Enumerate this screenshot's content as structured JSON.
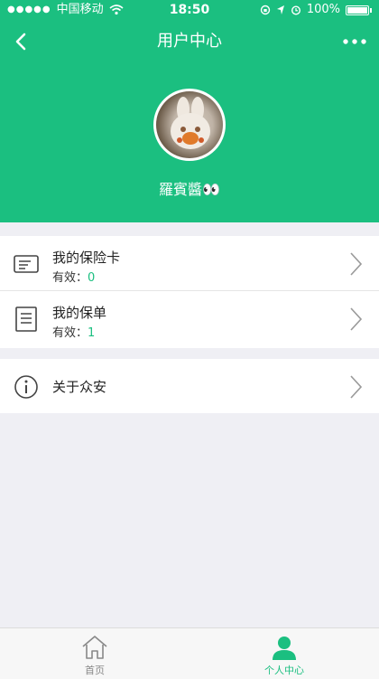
{
  "status_bar": {
    "carrier": "中国移动",
    "time": "18:50",
    "battery": "100%"
  },
  "navbar": {
    "title": "用户中心",
    "back_icon": "chevron-left-icon",
    "more_icon": "more-horizontal-icon"
  },
  "profile": {
    "username": "羅賓醬👀"
  },
  "menu": {
    "group1": [
      {
        "title": "我的保险卡",
        "sub_label": "有效：",
        "count": "0",
        "icon": "card-icon"
      },
      {
        "title": "我的保单",
        "sub_label": "有效：",
        "count": "1",
        "icon": "document-icon"
      }
    ],
    "group2": [
      {
        "title": "关于众安",
        "icon": "info-icon"
      }
    ]
  },
  "tabbar": {
    "items": [
      {
        "label": "首页",
        "icon": "home-icon",
        "active": false
      },
      {
        "label": "个人中心",
        "icon": "user-icon",
        "active": true
      }
    ]
  },
  "colors": {
    "brand": "#1bbf80",
    "background": "#efeff4"
  }
}
